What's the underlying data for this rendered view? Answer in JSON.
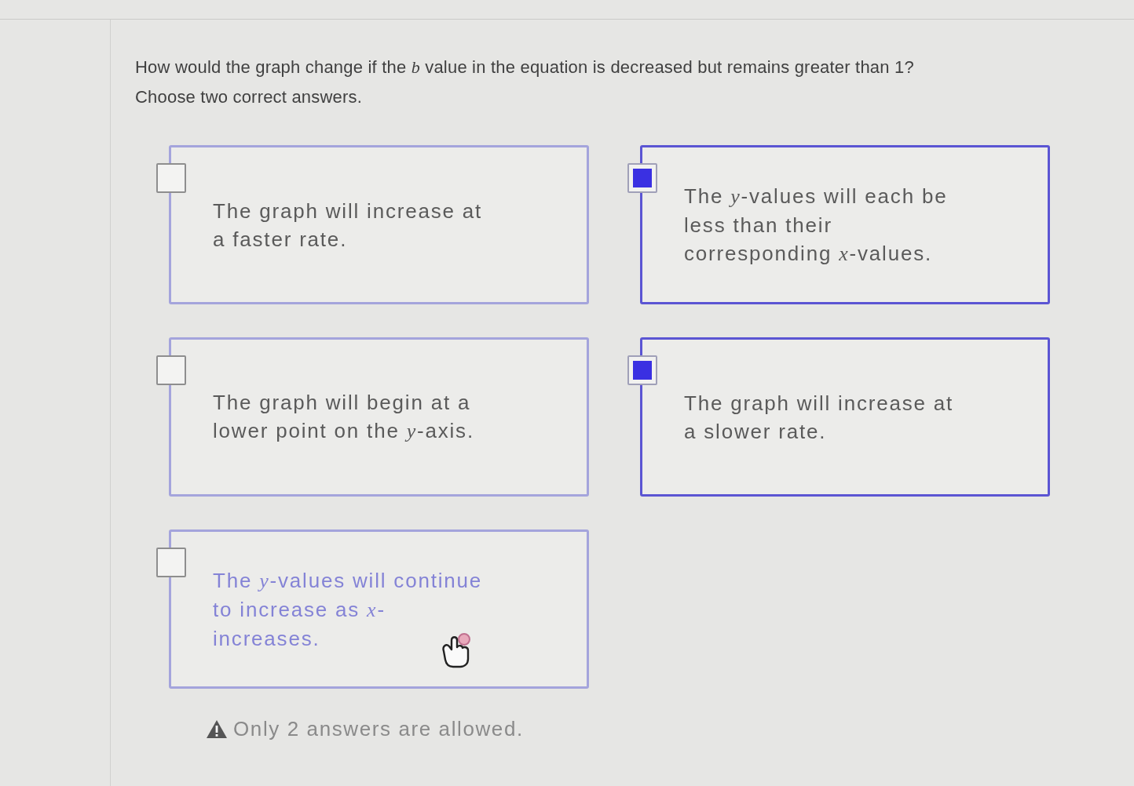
{
  "question": {
    "text": "How would the graph change if the *b* value in the equation is decreased but remains greater than 1?",
    "instruction": "Choose two correct answers."
  },
  "answers": [
    {
      "text": "The graph will increase at a faster rate.",
      "selected": false,
      "hovered": false
    },
    {
      "text": "The graph will begin at a lower point on the *y*-axis.",
      "selected": false,
      "hovered": false
    },
    {
      "text": "The *y*-values will continue to increase as *x*-increases.",
      "selected": false,
      "hovered": true
    },
    {
      "text": "The *y*-values will each be less than their corresponding *x*-values.",
      "selected": true,
      "hovered": false
    },
    {
      "text": "The graph will increase at a slower rate.",
      "selected": true,
      "hovered": false
    }
  ],
  "warning": "Only 2 answers are allowed."
}
